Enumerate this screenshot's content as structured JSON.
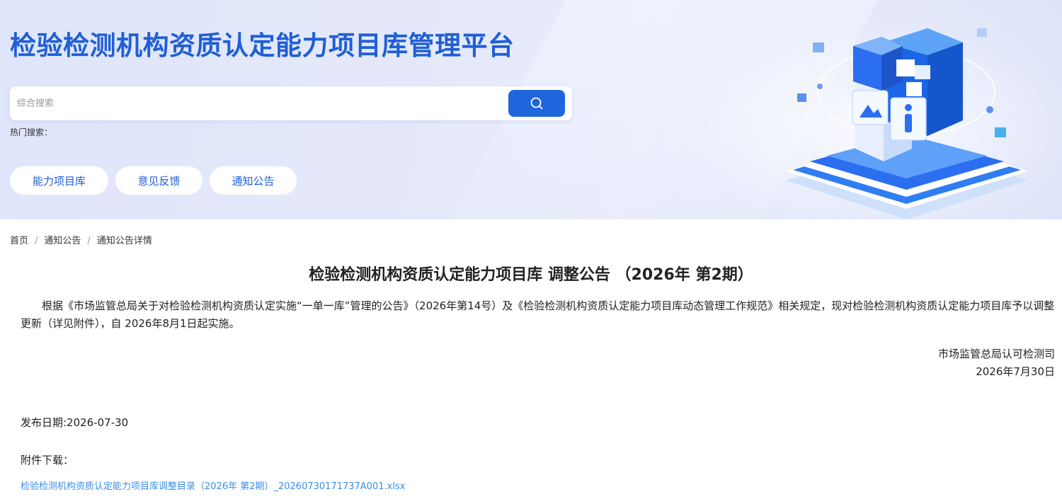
{
  "header": {
    "site_title": "检验检测机构资质认定能力项目库管理平台",
    "search": {
      "placeholder": "综合搜索",
      "value": ""
    },
    "hot_search_label": "热门搜索：",
    "nav": [
      {
        "label": "能力项目库"
      },
      {
        "label": "意见反馈"
      },
      {
        "label": "通知公告"
      }
    ],
    "accent_color": "#1f66dc",
    "title_color": "#1f5fd6"
  },
  "breadcrumb": [
    {
      "label": "首页"
    },
    {
      "label": "通知公告"
    },
    {
      "label": "通知公告详情"
    }
  ],
  "breadcrumb_separator": "/",
  "article": {
    "title": "检验检测机构资质认定能力项目库 调整公告 （2026年 第2期）",
    "body": "根据《市场监管总局关于对检验检测机构资质认定实施“一单一库”管理的公告》（2026年第14号）及《检验检测机构资质认定能力项目库动态管理工作规范》相关规定，现对检验检测机构资质认定能力项目库予以调整更新（详见附件），自 2026年8月1日起实施。",
    "issuer": "市场监管总局认可检测司",
    "issue_date": "2026年7月30日",
    "publish_date": "发布日期:2026-07-30",
    "attachment_label": "附件下载：",
    "attachment_file": "检验检测机构资质认定能力项目库调整目录（2026年 第2期）_20260730171737A001.xlsx",
    "link_color": "#3a8ee6"
  },
  "icons": {
    "search": "search-icon",
    "illustration": "data-cube-illustration"
  }
}
